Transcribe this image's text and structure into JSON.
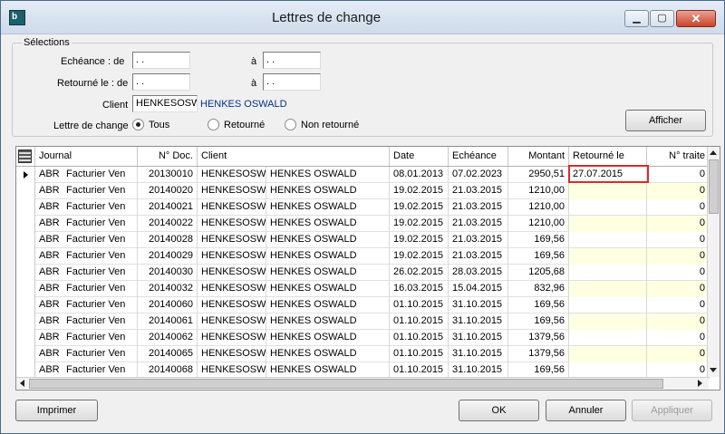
{
  "window": {
    "title": "Lettres de change",
    "icon_text": "b"
  },
  "selections": {
    "legend": "Sélections",
    "echeance_label": "Echéance : de",
    "echeance_from": ". .",
    "to_label": "à",
    "echeance_to": ". .",
    "retourne_label": "Retourné le : de",
    "retourne_from": ". .",
    "retourne_to": ". .",
    "client_label": "Client",
    "client_code": "HENKESOSW",
    "client_name": "HENKES OSWALD",
    "lettre_label": "Lettre de change",
    "radio_options": [
      "Tous",
      "Retourné",
      "Non retourné"
    ],
    "selected_radio": "Tous",
    "afficher_label": "Afficher"
  },
  "table": {
    "columns": [
      "Journal",
      "N° Doc.",
      "Client",
      "Date",
      "Echéance",
      "Montant",
      "Retourné le",
      "N° traite"
    ],
    "rows": [
      [
        "ABR",
        "Facturier Ven",
        "20130010",
        "HENKESOSW",
        "HENKES OSWALD",
        "08.01.2013",
        "07.02.2023",
        "2950,51",
        "27.07.2015",
        "0"
      ],
      [
        "ABR",
        "Facturier Ven",
        "20140020",
        "HENKESOSW",
        "HENKES OSWALD",
        "19.02.2015",
        "21.03.2015",
        "1210,00",
        "",
        "0"
      ],
      [
        "ABR",
        "Facturier Ven",
        "20140021",
        "HENKESOSW",
        "HENKES OSWALD",
        "19.02.2015",
        "21.03.2015",
        "1210,00",
        "",
        "0"
      ],
      [
        "ABR",
        "Facturier Ven",
        "20140022",
        "HENKESOSW",
        "HENKES OSWALD",
        "19.02.2015",
        "21.03.2015",
        "1210,00",
        "",
        "0"
      ],
      [
        "ABR",
        "Facturier Ven",
        "20140028",
        "HENKESOSW",
        "HENKES OSWALD",
        "19.02.2015",
        "21.03.2015",
        "169,56",
        "",
        "0"
      ],
      [
        "ABR",
        "Facturier Ven",
        "20140029",
        "HENKESOSW",
        "HENKES OSWALD",
        "19.02.2015",
        "21.03.2015",
        "169,56",
        "",
        "0"
      ],
      [
        "ABR",
        "Facturier Ven",
        "20140030",
        "HENKESOSW",
        "HENKES OSWALD",
        "26.02.2015",
        "28.03.2015",
        "1205,68",
        "",
        "0"
      ],
      [
        "ABR",
        "Facturier Ven",
        "20140032",
        "HENKESOSW",
        "HENKES OSWALD",
        "16.03.2015",
        "15.04.2015",
        "832,96",
        "",
        "0"
      ],
      [
        "ABR",
        "Facturier Ven",
        "20140060",
        "HENKESOSW",
        "HENKES OSWALD",
        "01.10.2015",
        "31.10.2015",
        "169,56",
        "",
        "0"
      ],
      [
        "ABR",
        "Facturier Ven",
        "20140061",
        "HENKESOSW",
        "HENKES OSWALD",
        "01.10.2015",
        "31.10.2015",
        "169,56",
        "",
        "0"
      ],
      [
        "ABR",
        "Facturier Ven",
        "20140062",
        "HENKESOSW",
        "HENKES OSWALD",
        "01.10.2015",
        "31.10.2015",
        "1379,56",
        "",
        "0"
      ],
      [
        "ABR",
        "Facturier Ven",
        "20140065",
        "HENKESOSW",
        "HENKES OSWALD",
        "01.10.2015",
        "31.10.2015",
        "1379,56",
        "",
        "0"
      ],
      [
        "ABR",
        "Facturier Ven",
        "20140068",
        "HENKESOSW",
        "HENKES OSWALD",
        "01.10.2015",
        "31.10.2015",
        "169,56",
        "",
        "0"
      ]
    ]
  },
  "buttons": {
    "print": "Imprimer",
    "ok": "OK",
    "cancel": "Annuler",
    "apply": "Appliquer"
  },
  "colors": {
    "highlight_border": "#d92b2b",
    "editable_cell": "#ffffe1",
    "client_name": "#00338c"
  }
}
